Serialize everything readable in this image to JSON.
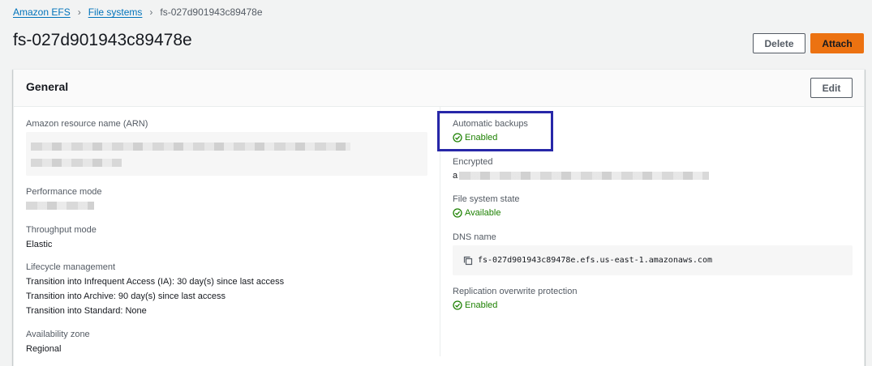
{
  "breadcrumb": {
    "root": "Amazon EFS",
    "parent": "File systems",
    "current": "fs-027d901943c89478e"
  },
  "page": {
    "title": "fs-027d901943c89478e",
    "delete_label": "Delete",
    "attach_label": "Attach"
  },
  "general": {
    "title": "General",
    "edit_label": "Edit",
    "arn_label": "Amazon resource name (ARN)",
    "performance_label": "Performance mode",
    "throughput_label": "Throughput mode",
    "throughput_value": "Elastic",
    "lifecycle_label": "Lifecycle management",
    "lifecycle_lines": [
      "Transition into Infrequent Access (IA): 30 day(s) since last access",
      "Transition into Archive: 90 day(s) since last access",
      "Transition into Standard: None"
    ],
    "az_label": "Availability zone",
    "az_value": "Regional",
    "backups_label": "Automatic backups",
    "backups_value": "Enabled",
    "encrypted_label": "Encrypted",
    "encrypted_prefix": "a",
    "state_label": "File system state",
    "state_value": "Available",
    "dns_label": "DNS name",
    "dns_value": "fs-027d901943c89478e.efs.us-east-1.amazonaws.com",
    "replication_label": "Replication overwrite protection",
    "replication_value": "Enabled"
  },
  "colors": {
    "link": "#0073bb",
    "primary": "#ec7211",
    "success": "#1d8102",
    "highlight": "#2727a8"
  },
  "icons": [
    "chevron-right-icon",
    "check-circle-icon",
    "copy-icon"
  ]
}
